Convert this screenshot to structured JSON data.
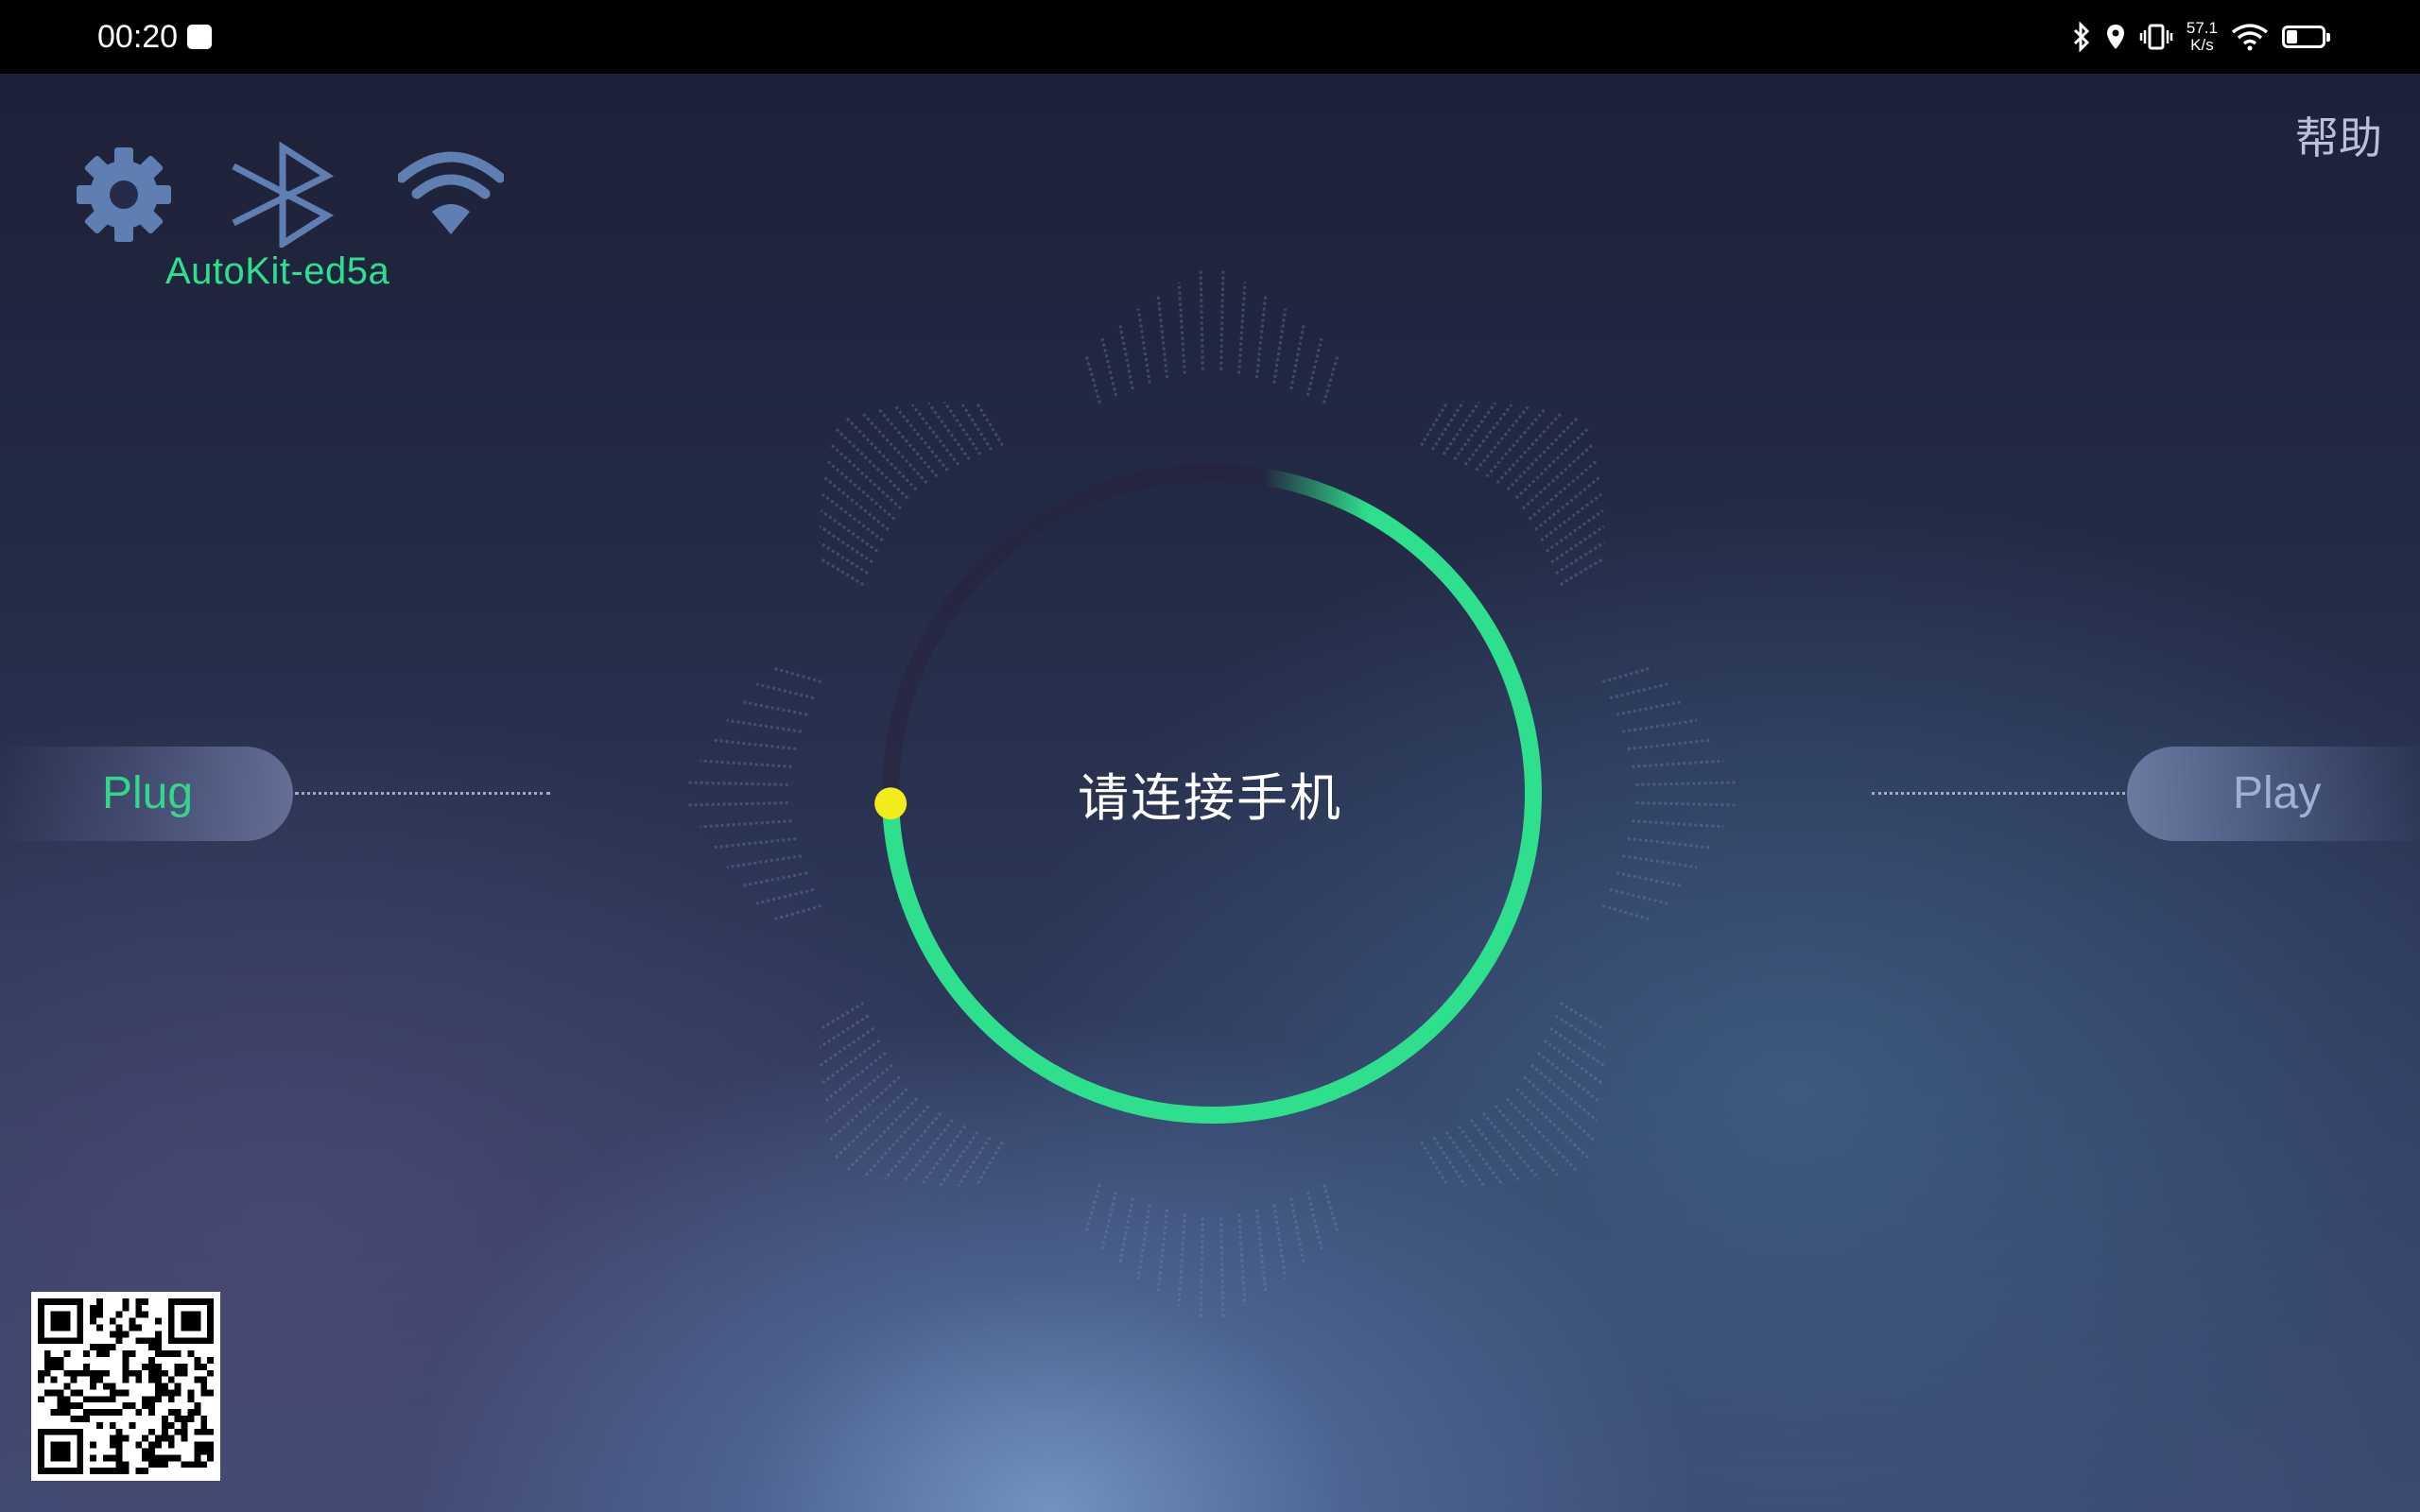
{
  "status_bar": {
    "time": "00:20",
    "network_speed_value": "57.1",
    "network_speed_unit": "K/s",
    "icons": [
      "message-icon",
      "bluetooth-icon",
      "location-icon",
      "vibrate-icon",
      "wifi-icon",
      "battery-icon"
    ],
    "battery_level": 0.3
  },
  "toolbar": {
    "icons": [
      "settings-icon",
      "bluetooth-icon",
      "wifi-icon"
    ]
  },
  "device_name": "AutoKit-ed5a",
  "help_label": "帮助",
  "left_button_label": "Plug",
  "right_button_label": "Play",
  "center_message": "请连接手机",
  "progress": {
    "shown_fraction": 0.72,
    "arc_color": "#2ee08e",
    "dot_color": "#f2ec1a"
  },
  "qr_code": "qr-code-icon"
}
